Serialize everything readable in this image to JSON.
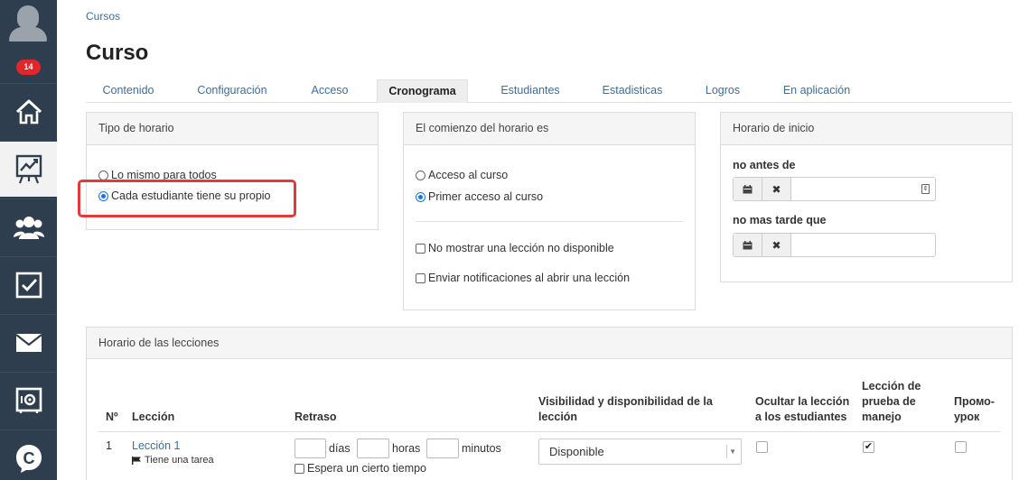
{
  "sidebar": {
    "badge_count": "14",
    "items": [
      {
        "icon": "home-icon"
      },
      {
        "icon": "chart-easel-icon",
        "active": true
      },
      {
        "icon": "users-icon"
      },
      {
        "icon": "checkbox-icon"
      },
      {
        "icon": "mail-icon"
      },
      {
        "icon": "safe-icon"
      },
      {
        "icon": "chat-c-icon"
      }
    ]
  },
  "breadcrumb": "Cursos",
  "page_title": "Curso",
  "tabs": [
    "Contenido",
    "Configuración",
    "Acceso",
    "Cronograma",
    "Estudiantes",
    "Estadisticas",
    "Logros",
    "En aplicación"
  ],
  "active_tab": "Cronograma",
  "schedule_type": {
    "title": "Tipo de horario",
    "options": [
      "Lo mismo para todos",
      "Cada estudiante tiene su propio"
    ],
    "selected": "Cada estudiante tiene su propio"
  },
  "schedule_start": {
    "title": "El comienzo del horario es",
    "options": [
      "Acceso al curso",
      "Primer acceso al curso"
    ],
    "selected": "Primer acceso al curso",
    "checkboxes": [
      "No mostrar una lección no disponible",
      "Enviar notificaciones al abrir una lección"
    ]
  },
  "start_time": {
    "title": "Horario de inicio",
    "not_before_label": "no antes de",
    "not_after_label": "no mas tarde que",
    "clear_symbol": "✖"
  },
  "lessons": {
    "title": "Horario de las lecciones",
    "columns": {
      "num": "Nº",
      "lesson": "Lección",
      "delay": "Retraso",
      "visibility": "Visibilidad y disponibilidad de la lección",
      "hide": "Ocultar la lección a los estudiantes",
      "test": "Lección de prueba de manejo",
      "promo": "Промо-урок"
    },
    "rows": [
      {
        "num": "1",
        "lesson": "Lección 1",
        "task_note": "Tiene una tarea",
        "days_label": "días",
        "hours_label": "horas",
        "minutes_label": "minutos",
        "wait_label": "Espera un cierto tiempo",
        "visibility": "Disponible",
        "hide_checked": false,
        "test_checked": true,
        "promo_checked": false,
        "check_mark": "✔"
      }
    ]
  },
  "colors": {
    "sidebar_bg": "#2f3e4e",
    "link": "#3a6ea5",
    "badge": "#e0282c",
    "highlight": "#e03a3a",
    "radio_selected": "#1a73e8"
  }
}
